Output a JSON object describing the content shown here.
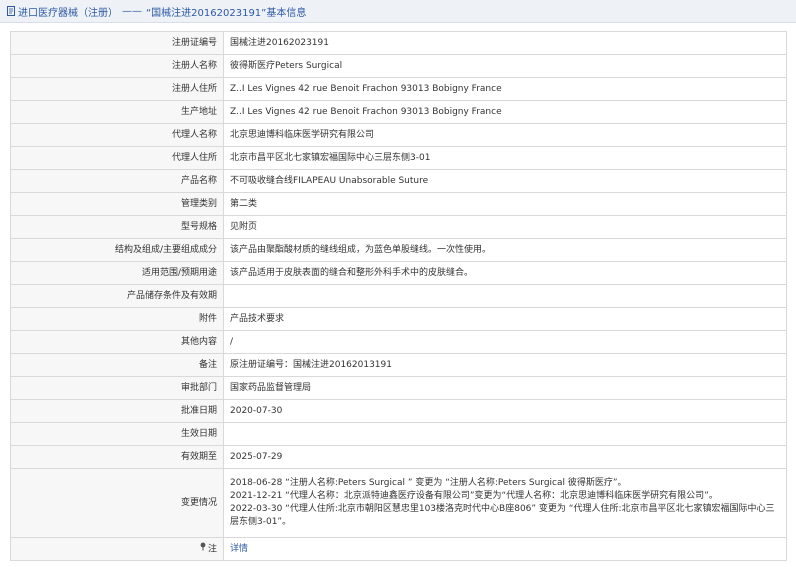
{
  "header": {
    "title_main": "进口医疗器械（注册）",
    "dash": "——",
    "title_sub": "“国械注进20162023191”基本信息",
    "icon": "back-document-icon"
  },
  "rows": [
    {
      "label": "注册证编号",
      "value": "国械注进20162023191"
    },
    {
      "label": "注册人名称",
      "value": "彼得斯医疗Peters Surgical"
    },
    {
      "label": "注册人住所",
      "value": "Z..I Les Vignes 42 rue Benoit Frachon 93013 Bobigny France"
    },
    {
      "label": "生产地址",
      "value": "Z..I Les Vignes 42 rue Benoit Frachon 93013 Bobigny France"
    },
    {
      "label": "代理人名称",
      "value": "北京思迪博科临床医学研究有限公司"
    },
    {
      "label": "代理人住所",
      "value": "北京市昌平区北七家镇宏福国际中心三层东侧3-01"
    },
    {
      "label": "产品名称",
      "value": "不可吸收缝合线FILAPEAU Unabsorable Suture"
    },
    {
      "label": "管理类别",
      "value": "第二类"
    },
    {
      "label": "型号规格",
      "value": "见附页"
    },
    {
      "label": "结构及组成/主要组成成分",
      "value": "该产品由聚酯酸材质的缝线组成，为蓝色单股缝线。一次性使用。"
    },
    {
      "label": "适用范围/预期用途",
      "value": "该产品适用于皮肤表面的缝合和整形外科手术中的皮肤缝合。"
    },
    {
      "label": "产品储存条件及有效期",
      "value": ""
    },
    {
      "label": "附件",
      "value": "产品技术要求"
    },
    {
      "label": "其他内容",
      "value": "/"
    },
    {
      "label": "备注",
      "value": "原注册证编号：国械注进20162013191"
    },
    {
      "label": "审批部门",
      "value": "国家药品监督管理局"
    },
    {
      "label": "批准日期",
      "value": "2020-07-30"
    },
    {
      "label": "生效日期",
      "value": ""
    },
    {
      "label": "有效期至",
      "value": "2025-07-29"
    }
  ],
  "changes": {
    "label": "变更情况",
    "lines": [
      "2018-06-28 “注册人名称:Peters Surgical ” 变更为 “注册人名称:Peters Surgical 彼得斯医疗”。",
      "2021-12-21 “代理人名称：北京派特迪鑫医疗设备有限公司”变更为“代理人名称：北京思迪博科临床医学研究有限公司”。",
      "2022-03-30 “代理人住所:北京市朝阳区慧忠里103楼洛克时代中心B座806” 变更为 “代理人住所:北京市昌平区北七家镇宏福国际中心三层东侧3-01”。"
    ]
  },
  "note": {
    "label": "注",
    "icon": "pin-icon",
    "link_text": "详情"
  }
}
